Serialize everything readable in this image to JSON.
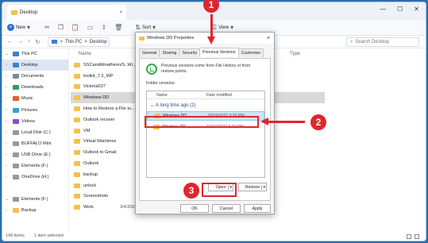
{
  "explorer": {
    "tab_title": "Desktop",
    "tab_close": "×",
    "win_controls": [
      "—",
      "☐",
      "✕"
    ],
    "cmd": {
      "new_label": "New",
      "sort_label": "Sort",
      "view_label": "View"
    },
    "address": {
      "crumbs": [
        "This PC",
        "Desktop"
      ],
      "separator": ">",
      "search_placeholder": "Search Desktop"
    },
    "sidebar": [
      {
        "label": "This PC",
        "expanded": true,
        "color": "#3d7fd6"
      },
      {
        "label": "Desktop",
        "active": true,
        "color": "#3d7fd6"
      },
      {
        "label": "Documents",
        "color": "#7a8aa0"
      },
      {
        "label": "Downloads",
        "color": "#2f9e5a"
      },
      {
        "label": "Music",
        "color": "#e06030"
      },
      {
        "label": "Pictures",
        "color": "#3aa0d0"
      },
      {
        "label": "Videos",
        "color": "#8a4ad0"
      },
      {
        "label": "Local Disk (C:)",
        "color": "#999999"
      },
      {
        "label": "BUFFALO Mini",
        "color": "#999999"
      },
      {
        "label": "USB Drive (E:)",
        "color": "#999999"
      },
      {
        "label": "Elements (F:)",
        "color": "#999999"
      },
      {
        "label": "OneDrive (H:)",
        "color": "#999999"
      },
      {
        "label": "",
        "color": "#ffffff"
      },
      {
        "label": "Elements (F:)",
        "expanded": true,
        "color": "#999999"
      },
      {
        "label": "Backup",
        "color": "#f2c14e"
      }
    ],
    "columns": {
      "name": "Name",
      "date": "",
      "type": "Type"
    },
    "files": [
      {
        "name": "SSCandidmatheon/S..Wi...",
        "date": "",
        "type": ""
      },
      {
        "name": "toolkit_7.2_WP",
        "date": "",
        "type": ""
      },
      {
        "name": "Victoria537",
        "date": "",
        "type": ""
      },
      {
        "name": "Windows DD",
        "date": "",
        "type": "",
        "selected": true
      },
      {
        "name": "How to Restore a File to...",
        "date": "",
        "type": ""
      },
      {
        "name": "Outlook recover",
        "date": "",
        "type": ""
      },
      {
        "name": "VM",
        "date": "",
        "type": ""
      },
      {
        "name": "Virtual Machines",
        "date": "",
        "type": ""
      },
      {
        "name": "Outlook to Gmail",
        "date": "",
        "type": ""
      },
      {
        "name": "Outlook",
        "date": "",
        "type": ""
      },
      {
        "name": "backup",
        "date": "",
        "type": ""
      },
      {
        "name": "unlock",
        "date": "",
        "type": ""
      },
      {
        "name": "Screenshots",
        "date": "",
        "type": ""
      },
      {
        "name": "Work",
        "date": "3/4/2022 10:47 AM",
        "type": "File folder"
      }
    ],
    "status": {
      "items": "149 items",
      "selected": "1 item selected"
    }
  },
  "dialog": {
    "title": "Windows DD Properties",
    "close": "×",
    "tabs": [
      "General",
      "Sharing",
      "Security",
      "Previous Versions",
      "Customize"
    ],
    "active_tab": "Previous Versions",
    "description": "Previous versions come from File History or from restore points.",
    "folder_versions_label": "Folder versions:",
    "col_name": "Name",
    "col_date": "Date modified",
    "group": "A long time ago (2)",
    "versions": [
      {
        "name": "Windows DD",
        "date": "10/19/2022 3:29 PM",
        "selected": true
      },
      {
        "name": "Windows DD",
        "date": "10/10/2022 3:24 PM"
      }
    ],
    "buttons": {
      "open": "Open",
      "restore": "Restore",
      "ok": "OK",
      "cancel": "Cancel",
      "apply": "Apply"
    }
  },
  "annotations": {
    "step1": "1",
    "step2": "2",
    "step3": "3",
    "accent": "#e0262e"
  }
}
